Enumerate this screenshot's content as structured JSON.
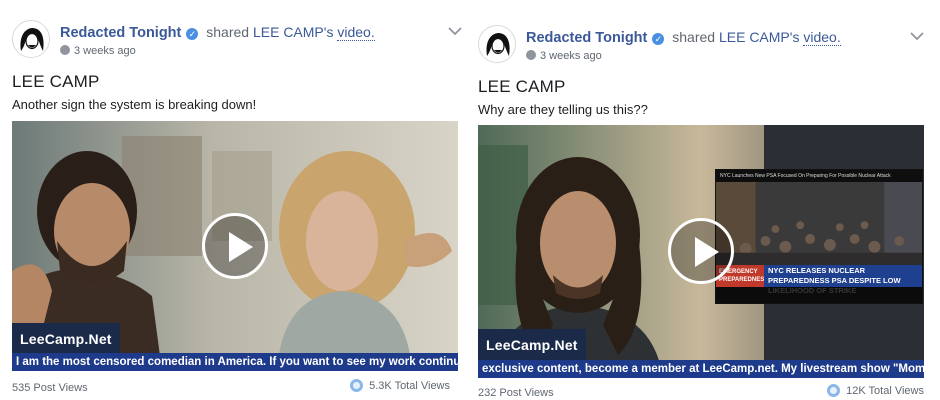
{
  "posts": [
    {
      "page_name": "Redacted Tonight",
      "shared_text": "shared",
      "author": "LEE CAMP's",
      "link_text": "video.",
      "time": "3 weeks ago",
      "title": "LEE CAMP",
      "caption": "Another sign the system is breaking down!",
      "logo_text": "LeeCamp.Net",
      "ticker": "I am the most censored comedian in America. If you want to see my work continue & get exclusive",
      "post_views": "535 Post Views",
      "total_views": "5.3K Total Views"
    },
    {
      "page_name": "Redacted Tonight",
      "shared_text": "shared",
      "author": "LEE CAMP's",
      "link_text": "video.",
      "time": "3 weeks ago",
      "title": "LEE CAMP",
      "caption": "Why are they telling us this??",
      "logo_text": "LeeCamp.Net",
      "ticker": "exclusive content, become a member at LeeCamp.net. My livestream show \"Moment of Clarity\" is",
      "inset_title": "NYC Launches New PSA Focused On Preparing For Possible Nuclear Attack",
      "inset_lower_left": "EMERGENCY PREPAREDNESS",
      "inset_headline": "NYC RELEASES NUCLEAR PREPAREDNESS PSA DESPITE LOW LIKELIHOOD OF STRIKE",
      "post_views": "232 Post Views",
      "total_views": "12K Total Views"
    }
  ],
  "icons": {
    "verified": "verified-badge-icon",
    "globe": "globe-icon",
    "menu": "chevron-down-icon",
    "play": "play-icon",
    "views": "views-circle-icon"
  },
  "colors": {
    "link": "#3b5998",
    "ticker_bg": "#1e3a8a",
    "logo_bg": "#1c2a4a"
  }
}
